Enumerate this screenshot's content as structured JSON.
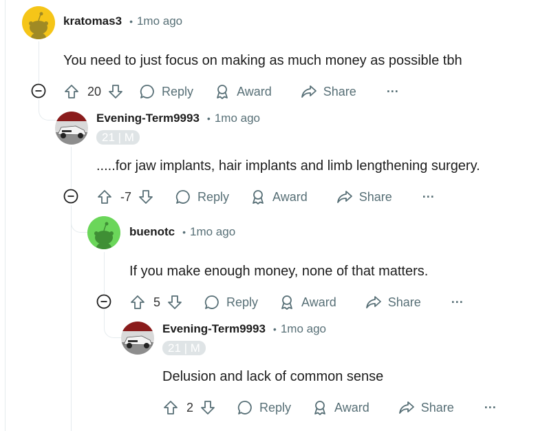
{
  "comments": [
    {
      "author": "kratomas3",
      "age": "1mo ago",
      "text": "You need to just focus on making as much money as possible tbh",
      "score": "20",
      "avatar": "snoo-yellow"
    },
    {
      "author": "Evening-Term9993",
      "age": "1mo ago",
      "flair": "21 | M",
      "text": ".....for jaw implants, hair implants and limb lengthening surgery.",
      "score": "-7",
      "avatar": "car-photo"
    },
    {
      "author": "buenotc",
      "age": "1mo ago",
      "text": "If you make enough money, none of that matters.",
      "score": "5",
      "avatar": "snoo-green"
    },
    {
      "author": "Evening-Term9993",
      "age": "1mo ago",
      "flair": "21 | M",
      "text": "Delusion and lack of common sense",
      "score": "2",
      "avatar": "car-photo"
    }
  ],
  "actions": {
    "reply": "Reply",
    "award": "Award",
    "share": "Share",
    "more": "···"
  },
  "separator": "•",
  "colors": {
    "meta": "#576f76",
    "thread_line": "#e5ebee",
    "snoo_yellow": "#f5c518",
    "snoo_green": "#6bd65a",
    "flair_bg": "#dfe4e6"
  }
}
